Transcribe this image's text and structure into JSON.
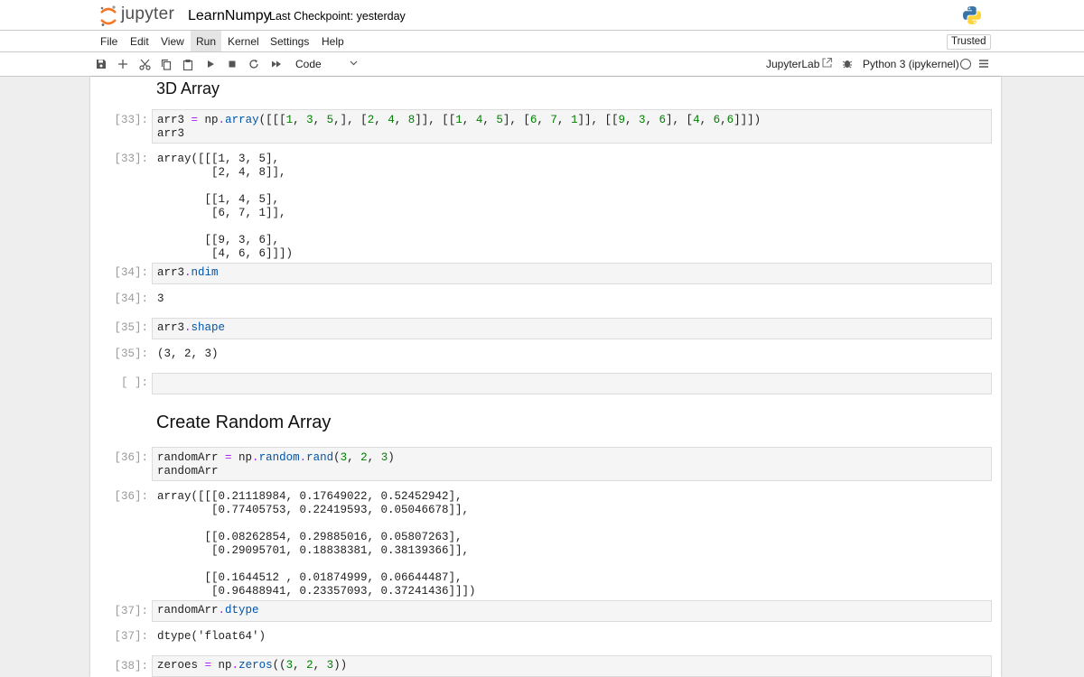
{
  "header": {
    "brand": "jupyter",
    "notebook_name": "LearnNumpy",
    "checkpoint": "Last Checkpoint: yesterday"
  },
  "menu": {
    "items": [
      "File",
      "Edit",
      "View",
      "Run",
      "Kernel",
      "Settings",
      "Help"
    ],
    "active": "Run",
    "trusted": "Trusted"
  },
  "toolbar": {
    "cell_type": "Code",
    "jupyterlab": "JupyterLab",
    "kernel": "Python 3 (ipykernel)"
  },
  "icons": {
    "save": "save-icon",
    "add": "plus-icon",
    "cut": "scissors-icon",
    "copy": "copy-icon",
    "paste": "paste-icon",
    "run": "play-icon",
    "stop": "stop-icon",
    "restart": "restart-icon",
    "run_all": "fast-forward-icon",
    "dropdown": "chevron-down-icon",
    "external": "external-link-icon",
    "debugger": "bug-icon",
    "kernel_status": "circle-icon",
    "kernel_menu": "hamburger-icon"
  },
  "colors": {
    "keyword": "#0055aa",
    "operator": "#aa22ff",
    "number": "#008000",
    "prompt": "#9a9a9a"
  },
  "notebook": {
    "heading_3d": "3D Array",
    "heading_random": "Create Random Array",
    "cells": [
      {
        "prompt": "[33]:",
        "out_prompt": "[33]:",
        "output": "array([[[1, 3, 5],\n        [2, 4, 8]],\n\n       [[1, 4, 5],\n        [6, 7, 1]],\n\n       [[9, 3, 6],\n        [4, 6, 6]]])"
      },
      {
        "prompt": "[34]:",
        "out_prompt": "[34]:",
        "output": "3"
      },
      {
        "prompt": "[35]:",
        "out_prompt": "[35]:",
        "output": "(3, 2, 3)"
      },
      {
        "prompt": "[ ]:"
      },
      {
        "prompt": "[36]:",
        "out_prompt": "[36]:",
        "output": "array([[[0.21118984, 0.17649022, 0.52452942],\n        [0.77405753, 0.22419593, 0.05046678]],\n\n       [[0.08262854, 0.29885016, 0.05807263],\n        [0.29095701, 0.18838381, 0.38139366]],\n\n       [[0.1644512 , 0.01874999, 0.06644487],\n        [0.96488941, 0.23357093, 0.37241436]]])"
      },
      {
        "prompt": "[37]:",
        "out_prompt": "[37]:",
        "output": "dtype('float64')"
      },
      {
        "prompt": "[38]:"
      }
    ]
  }
}
